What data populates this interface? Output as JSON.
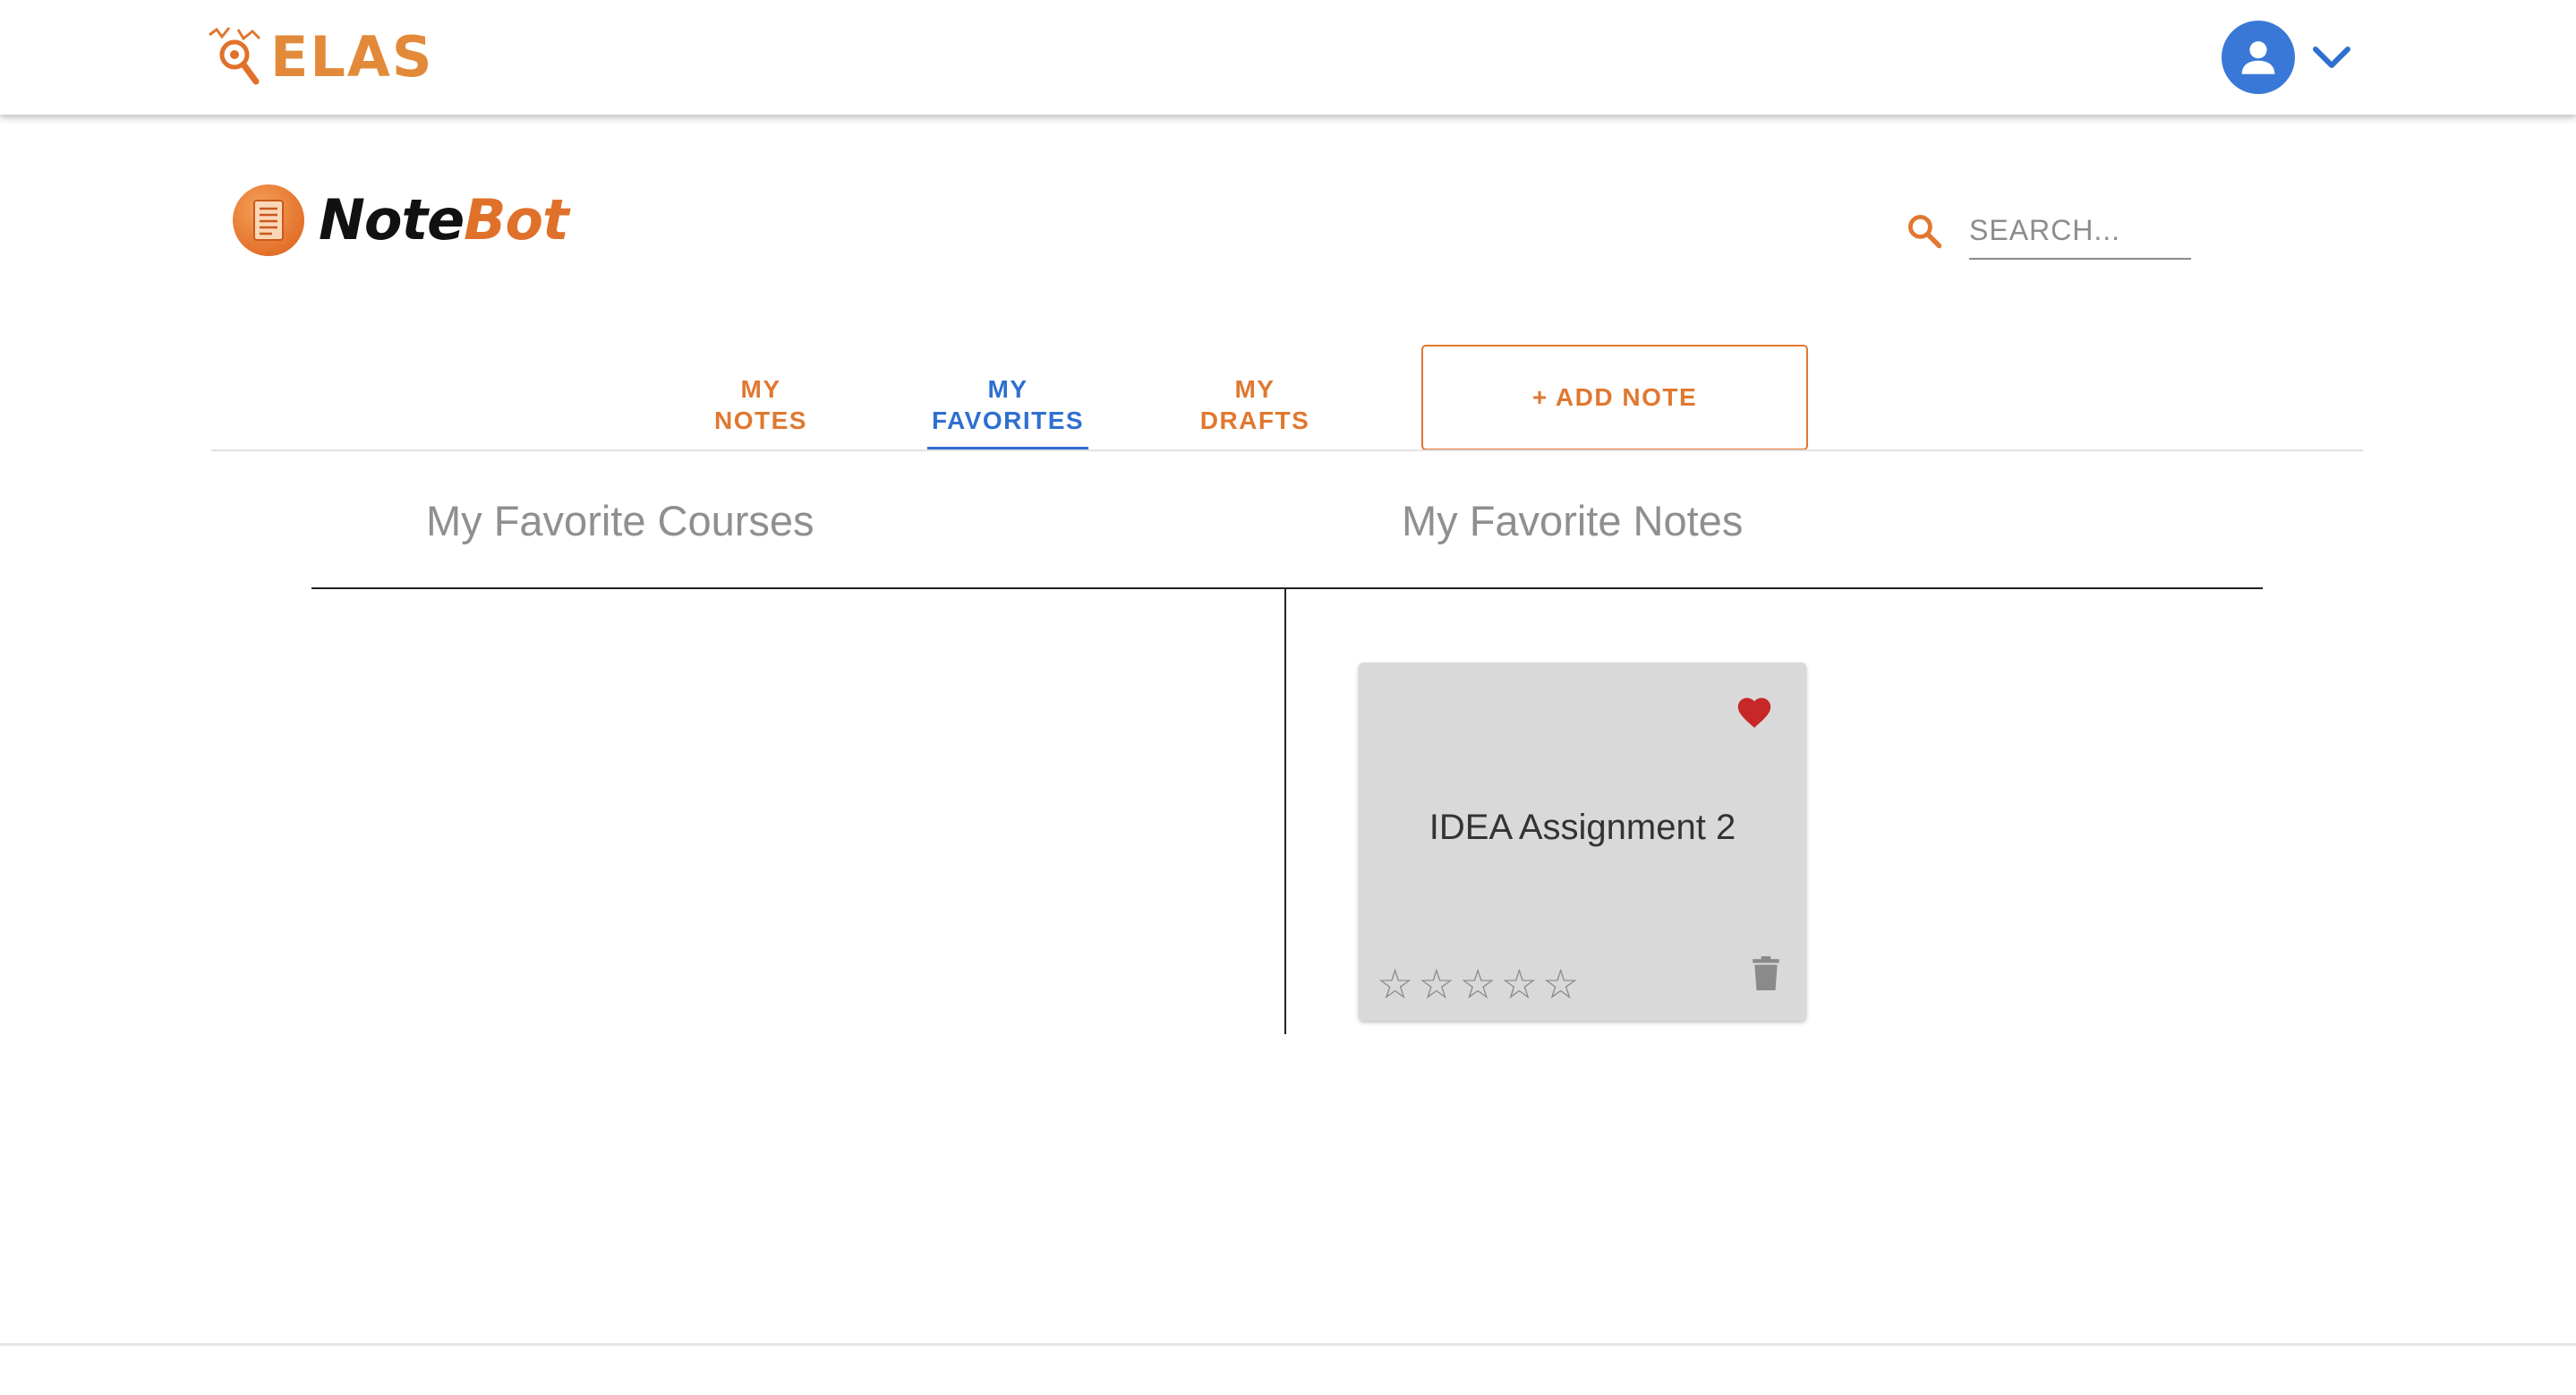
{
  "app": {
    "brand": "ELAS"
  },
  "header": {
    "title_part1": "Note",
    "title_part2": "Bot",
    "search": {
      "placeholder": "SEARCH...",
      "value": ""
    }
  },
  "tabs": [
    {
      "label": "MY\nNOTES",
      "active": false
    },
    {
      "label": "MY\nFAVORITES",
      "active": true
    },
    {
      "label": "MY\nDRAFTS",
      "active": false
    }
  ],
  "add_note_label": "+ ADD NOTE",
  "sections": {
    "courses_title": "My Favorite Courses",
    "notes_title": "My Favorite Notes"
  },
  "favorite_notes": [
    {
      "title": "IDEA Assignment 2",
      "favorited": true,
      "rating": 0,
      "max_rating": 5
    }
  ],
  "colors": {
    "accent_orange": "#e0782f",
    "accent_blue": "#2f6fd0",
    "heart_red": "#c62828",
    "card_bg": "#d9d9d9"
  },
  "icons": [
    "elas-logo-icon",
    "account-icon",
    "chevron-down-icon",
    "notebot-logo-icon",
    "search-icon",
    "heart-icon",
    "star-outline-icon",
    "trash-icon"
  ]
}
